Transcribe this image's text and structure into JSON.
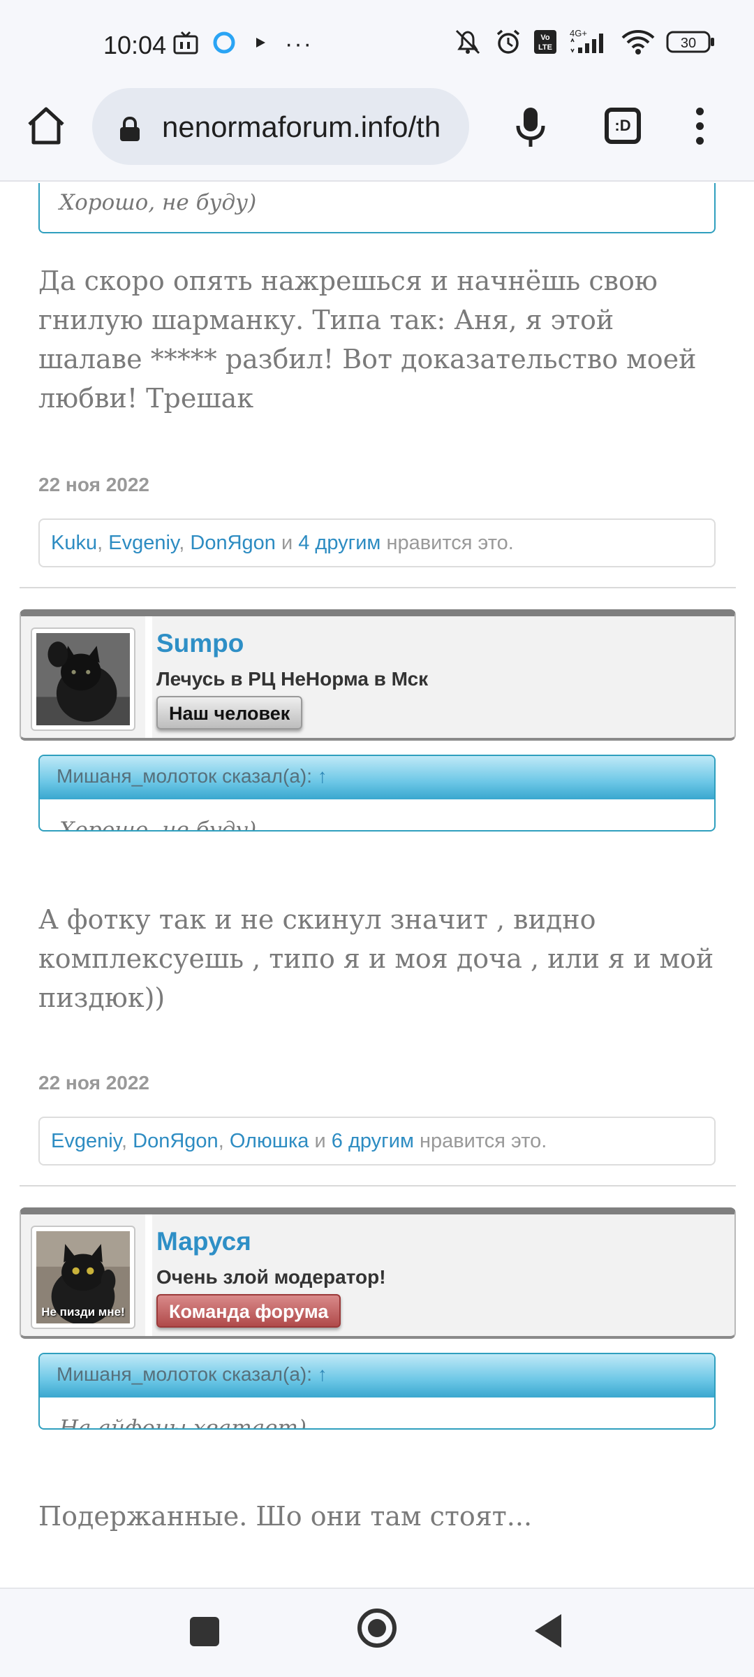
{
  "status_bar": {
    "time": "10:04",
    "network": "4G+",
    "volte": "Vo LTE",
    "battery": "30",
    "more_glyph": "···"
  },
  "browser": {
    "url": "nenormaforum.info/th",
    "tabs_label": ":D",
    "icons": [
      "home-icon",
      "lock-icon",
      "mic-icon",
      "tab-switcher-icon",
      "more-vert-icon"
    ]
  },
  "thread": {
    "top_quote_text": "Хорошо, не буду)",
    "post1": {
      "message": "Да скоро опять нажрешься и начнёшь свою гнилую шарманку. Типа так: Аня, я этой шалаве ***** разбил! Вот доказательство моей любви! Трешак",
      "date": "22 ноя 2022",
      "likes": {
        "users": [
          "Kuku",
          "Evgeniy",
          "DonЯgon"
        ],
        "and": "и",
        "others": "4 другим",
        "suffix": "нравится это."
      }
    },
    "post2": {
      "author": "Sumpo",
      "author_title": "Лечусь в РЦ НеНорма в Мск",
      "badge": "Наш человек",
      "quote_author": "Мишаня_молоток сказал(а):",
      "quote_arrow": "↑",
      "quote_text": "Хорошо, не буду)",
      "message": "А фотку так и не скинул значит , видно комплексуешь , типо я и моя доча , или я и мой пиздюк))",
      "date": "22 ноя 2022",
      "likes": {
        "users": [
          "Evgeniy",
          "DonЯgon",
          "Олюшка"
        ],
        "and": "и",
        "others": "6 другим",
        "suffix": "нравится это."
      }
    },
    "post3": {
      "author": "Маруся",
      "author_title": "Очень злой модератор!",
      "badge": "Команда форума",
      "avatar_caption": "Не пизди мне!",
      "quote_author": "Мишаня_молоток сказал(а):",
      "quote_arrow": "↑",
      "quote_text": "На айфоны хватает)",
      "message": "Подержанные. Шо они там стоят..."
    }
  },
  "colors": {
    "link": "#2d8cc2",
    "username": "#2e8fc6",
    "quote_border": "#2f9fbe",
    "badge_red": "#b04a4a"
  }
}
